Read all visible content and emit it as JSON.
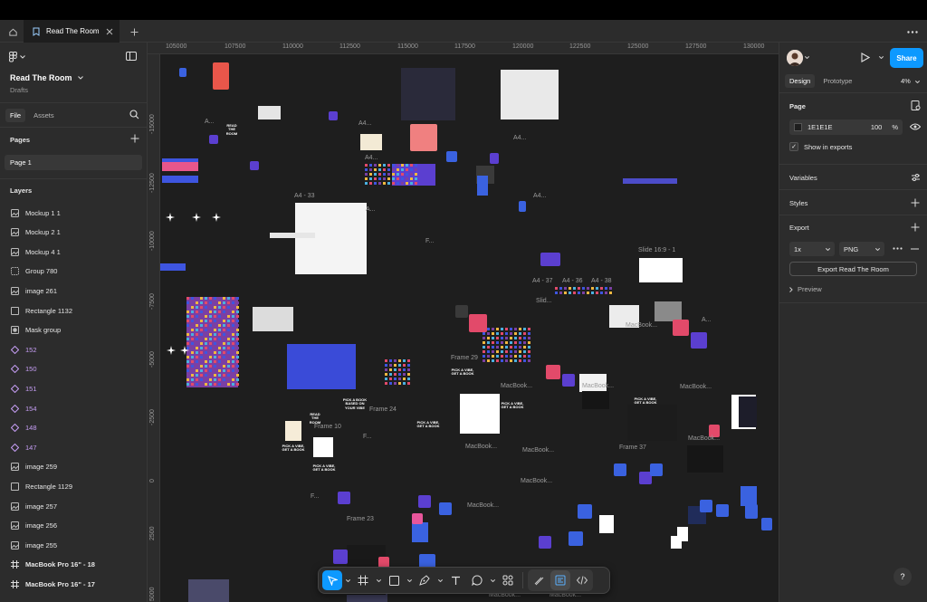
{
  "app": {
    "tab_title": "Read The Room"
  },
  "left_panel": {
    "file_name": "Read The Room",
    "location": "Drafts",
    "tabs": [
      "File",
      "Assets"
    ],
    "pages_heading": "Pages",
    "pages": [
      "Page 1"
    ],
    "layers_heading": "Layers",
    "layers": [
      {
        "label": "Mockup 1 1",
        "icon": "image-icon",
        "style": "normal"
      },
      {
        "label": "Mockup 2 1",
        "icon": "image-icon",
        "style": "normal"
      },
      {
        "label": "Mockup 4 1",
        "icon": "image-icon",
        "style": "normal"
      },
      {
        "label": "Group 780",
        "icon": "group-icon",
        "style": "normal"
      },
      {
        "label": "image 261",
        "icon": "image-icon",
        "style": "normal"
      },
      {
        "label": "Rectangle 1132",
        "icon": "rectangle-icon",
        "style": "normal"
      },
      {
        "label": "Mask group",
        "icon": "mask-icon",
        "style": "normal"
      },
      {
        "label": "152",
        "icon": "component-icon",
        "style": "purple"
      },
      {
        "label": "150",
        "icon": "component-icon",
        "style": "purple"
      },
      {
        "label": "151",
        "icon": "component-icon",
        "style": "purple"
      },
      {
        "label": "154",
        "icon": "component-icon",
        "style": "purple"
      },
      {
        "label": "148",
        "icon": "component-icon",
        "style": "purple"
      },
      {
        "label": "147",
        "icon": "component-icon",
        "style": "purple"
      },
      {
        "label": "image 259",
        "icon": "image-icon",
        "style": "normal"
      },
      {
        "label": "Rectangle 1129",
        "icon": "rectangle-icon",
        "style": "normal"
      },
      {
        "label": "image 257",
        "icon": "image-icon",
        "style": "normal"
      },
      {
        "label": "image 256",
        "icon": "image-icon",
        "style": "normal"
      },
      {
        "label": "image 255",
        "icon": "image-icon",
        "style": "normal"
      },
      {
        "label": "MacBook Pro 16\" - 18",
        "icon": "frame-icon",
        "style": "bold"
      },
      {
        "label": "MacBook Pro 16\" - 17",
        "icon": "frame-icon",
        "style": "bold"
      }
    ]
  },
  "canvas": {
    "ruler_x": [
      "105000",
      "107500",
      "110000",
      "112500",
      "115000",
      "117500",
      "120000",
      "122500",
      "125000",
      "127500",
      "130000"
    ],
    "ruler_y": [
      "-15000",
      "-12500",
      "-10000",
      "-7500",
      "-5000",
      "-2500",
      "0",
      "2500",
      "5000"
    ],
    "frame_labels": {
      "a4_33": "A4 - 33",
      "slide_16_9_1": "Slide 16:9 - 1",
      "a4_37": "A4 - 37",
      "a4_36": "A4 - 36",
      "a4_38": "A4 - 38",
      "frame_29": "Frame 29",
      "frame_24": "Frame 24",
      "frame_10": "Frame 10",
      "frame_37": "Frame 37",
      "frame_23": "Frame 23",
      "macbook": "MacBook...",
      "a4_short": "A4...",
      "slide_short": "Slid...",
      "f_short": "F...",
      "a_short": "A..."
    },
    "artwork_text": {
      "read_the_room": "READ THE ROOM",
      "pick_a_vibe": "PICK A VIBE, GET A BOOK",
      "pick_a_book": "PICK A BOOK BASED ON YOUR VIBE"
    }
  },
  "toolbar": {
    "tools": [
      "move-icon",
      "frame-icon",
      "rectangle-icon",
      "pen-icon",
      "text-icon",
      "comment-icon",
      "components-icon",
      "draw-mode-icon",
      "design-mode-icon",
      "dev-mode-icon"
    ]
  },
  "right_panel": {
    "share_label": "Share",
    "tabs": [
      "Design",
      "Prototype"
    ],
    "zoom": "4%",
    "page_heading": "Page",
    "fill_hex": "1E1E1E",
    "fill_opacity": "100",
    "fill_unit": "%",
    "show_in_exports": "Show in exports",
    "variables_heading": "Variables",
    "styles_heading": "Styles",
    "export_heading": "Export",
    "export_scale": "1x",
    "export_format": "PNG",
    "export_button": "Export Read The Room",
    "preview_label": "Preview",
    "help": "?"
  }
}
